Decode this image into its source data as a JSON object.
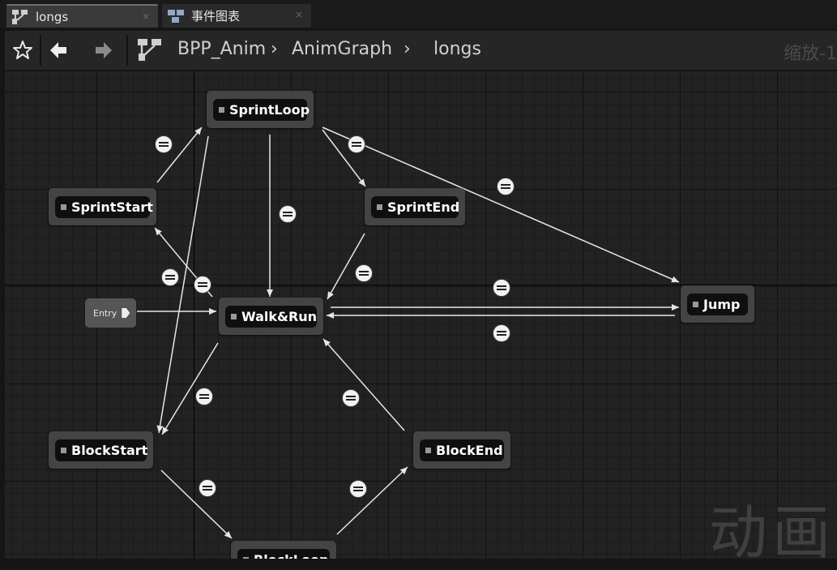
{
  "tabs": [
    {
      "label": "longs",
      "icon": "state-machine-icon",
      "close": "×"
    },
    {
      "label": "事件图表",
      "icon": "event-graph-icon",
      "close": "×"
    }
  ],
  "toolbar": {
    "breadcrumb": [
      "BPP_Anim",
      "AnimGraph",
      "longs"
    ],
    "separator_glyph": "›",
    "zoom_label": "缩放-1"
  },
  "graph": {
    "entry_label": "Entry",
    "nodes": {
      "sprint_loop": "SprintLoop",
      "sprint_start": "SprintStart",
      "sprint_end": "SprintEnd",
      "walk_run": "Walk&Run",
      "jump": "Jump",
      "block_start": "BlockStart",
      "block_end": "BlockEnd",
      "block_loop": "BlockLoop"
    },
    "watermark": "动画"
  },
  "colors": {
    "grid_bg": "#222222",
    "node_bg": "#444444",
    "node_title_bg": "#0f0f0f",
    "edge": "#e6e6e6",
    "transition_icon": "#f2f2f2"
  }
}
